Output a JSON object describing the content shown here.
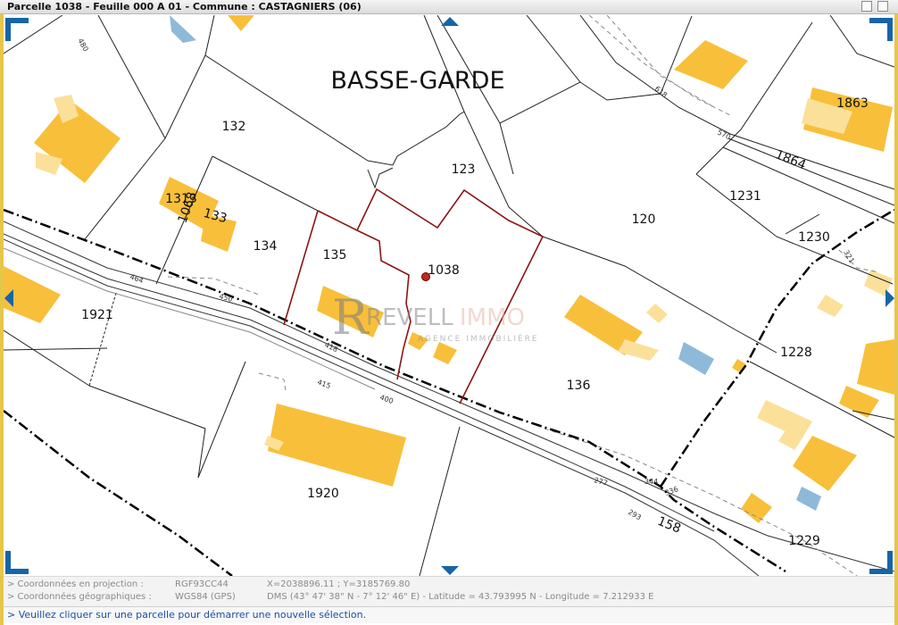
{
  "window": {
    "title": "Parcelle 1038 - Feuille 000 A 01 - Commune : CASTAGNIERS (06)"
  },
  "map": {
    "lieu_dit": "BASSE-GARDE",
    "parcels": [
      "132",
      "123",
      "1313",
      "1068",
      "133",
      "134",
      "135",
      "1038",
      "120",
      "1231",
      "1230",
      "1864",
      "1863",
      "1921",
      "136",
      "1228",
      "1920",
      "1229"
    ],
    "small_labels": [
      "480",
      "618",
      "570",
      "464",
      "450",
      "418",
      "415",
      "400",
      "277",
      "344",
      "336",
      "293",
      "321"
    ],
    "road_label": "158",
    "selected_parcel": "1038",
    "watermark": {
      "brand_left": "REVELL",
      "brand_right": "IMMO",
      "tagline": "AGENCE IMMOBILIÈRE"
    },
    "colors": {
      "building": "#f8bf3a",
      "building_light": "#fbe09a",
      "water": "#8fb9d9",
      "selection": "#8b1414",
      "nav": "#1565a8"
    }
  },
  "coordinates": {
    "projection": {
      "label": "> Coordonnées en projection :",
      "system": "RGF93CC44",
      "value": "X=2038896.11 ; Y=3185769.80"
    },
    "geographic": {
      "label": "> Coordonnées géographiques :",
      "system": "WGS84 (GPS)",
      "value": "DMS (43° 47' 38\" N - 7° 12' 46\" E) - Latitude = 43.793995 N - Longitude = 7.212933 E"
    }
  },
  "status": {
    "message": "> Veuillez cliquer sur une parcelle pour démarrer une nouvelle sélection."
  }
}
